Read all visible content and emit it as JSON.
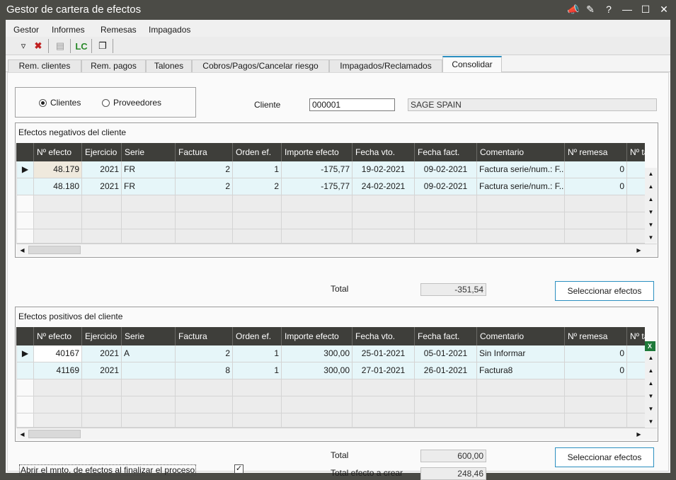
{
  "window": {
    "title": "Gestor de cartera de efectos"
  },
  "menu": [
    "Gestor",
    "Informes",
    "Remesas",
    "Impagados"
  ],
  "tabs": [
    "Rem. clientes",
    "Rem. pagos",
    "Talones",
    "Cobros/Pagos/Cancelar riesgo",
    "Impagados/Reclamados",
    "Consolidar"
  ],
  "active_tab": "Consolidar",
  "radios": {
    "clientes": "Clientes",
    "proveedores": "Proveedores",
    "selected": "Clientes"
  },
  "cliente": {
    "label": "Cliente",
    "code": "000001",
    "name": "SAGE SPAIN"
  },
  "columns": [
    "Nº efecto",
    "Ejercicio",
    "Serie",
    "Factura",
    "Orden ef.",
    "Importe efecto",
    "Fecha vto.",
    "Fecha fact.",
    "Comentario",
    "Nº remesa",
    "Nº ta"
  ],
  "negativos": {
    "title": "Efectos negativos del cliente",
    "rows": [
      [
        "48.179",
        "2021",
        "FR",
        "2",
        "1",
        "-175,77",
        "19-02-2021",
        "09-02-2021",
        "Factura serie/num.: F...",
        "0",
        ""
      ],
      [
        "48.180",
        "2021",
        "FR",
        "2",
        "2",
        "-175,77",
        "24-02-2021",
        "09-02-2021",
        "Factura serie/num.: F...",
        "0",
        ""
      ]
    ],
    "total_label": "Total",
    "total": "-351,54",
    "button": "Seleccionar efectos"
  },
  "positivos": {
    "title": "Efectos positivos del cliente",
    "rows": [
      [
        "40167",
        "2021",
        "A",
        "2",
        "1",
        "300,00",
        "25-01-2021",
        "05-01-2021",
        "Sin Informar",
        "0",
        ""
      ],
      [
        "41169",
        "2021",
        "",
        "8",
        "1",
        "300,00",
        "27-01-2021",
        "26-01-2021",
        "Factura8",
        "0",
        ""
      ]
    ],
    "total_label": "Total",
    "total": "600,00",
    "crear_label": "Total efecto a crear",
    "crear": "248,46",
    "button": "Seleccionar efectos"
  },
  "abrir": {
    "label": "Abrir el mnto. de efectos al finalizar el proceso",
    "checked": true
  },
  "icons": [
    "filter-icon",
    "clear-filter-icon",
    "document-icon",
    "lc-icon",
    "copy-icon",
    "megaphone-icon",
    "pin-icon",
    "help-icon",
    "minimize-icon",
    "maximize-icon",
    "close-icon",
    "excel-icon"
  ],
  "colors": {
    "header_bg": "#3e3e3a",
    "row_bg": "#e6f6f9",
    "accent": "#2b8fc0",
    "titlebar": "#4b4b46"
  }
}
